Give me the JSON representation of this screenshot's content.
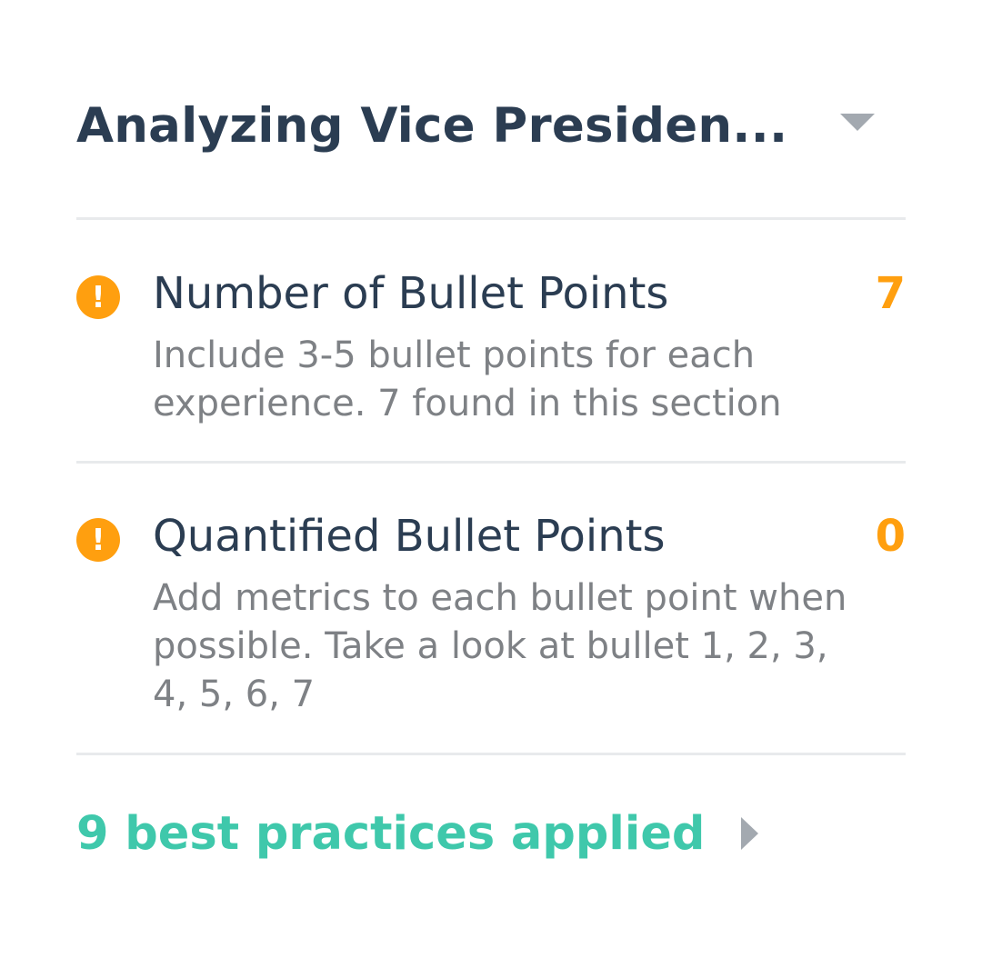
{
  "header": {
    "title": "Analyzing Vice Presiden...",
    "dropdown_icon": "chevron-down-icon"
  },
  "checks": [
    {
      "icon": "warning-icon",
      "icon_glyph": "!",
      "title": "Number of Bullet Points",
      "count": "7",
      "description": "Include 3-5 bullet points for each experience. 7 found in this section"
    },
    {
      "icon": "warning-icon",
      "icon_glyph": "!",
      "title": "Quantified Bullet Points",
      "count": "0",
      "description": "Add metrics to each bullet point when possible. Take a look at bullet 1, 2, 3, 4, 5, 6, 7"
    }
  ],
  "footer": {
    "label": "9 best practices applied",
    "arrow_icon": "chevron-right-icon"
  },
  "colors": {
    "title": "#2b3d52",
    "warning": "#ff9f0f",
    "description": "#7e8185",
    "success": "#3fc8ab",
    "chevron": "#a3a9b0",
    "divider": "#e8eaec"
  }
}
